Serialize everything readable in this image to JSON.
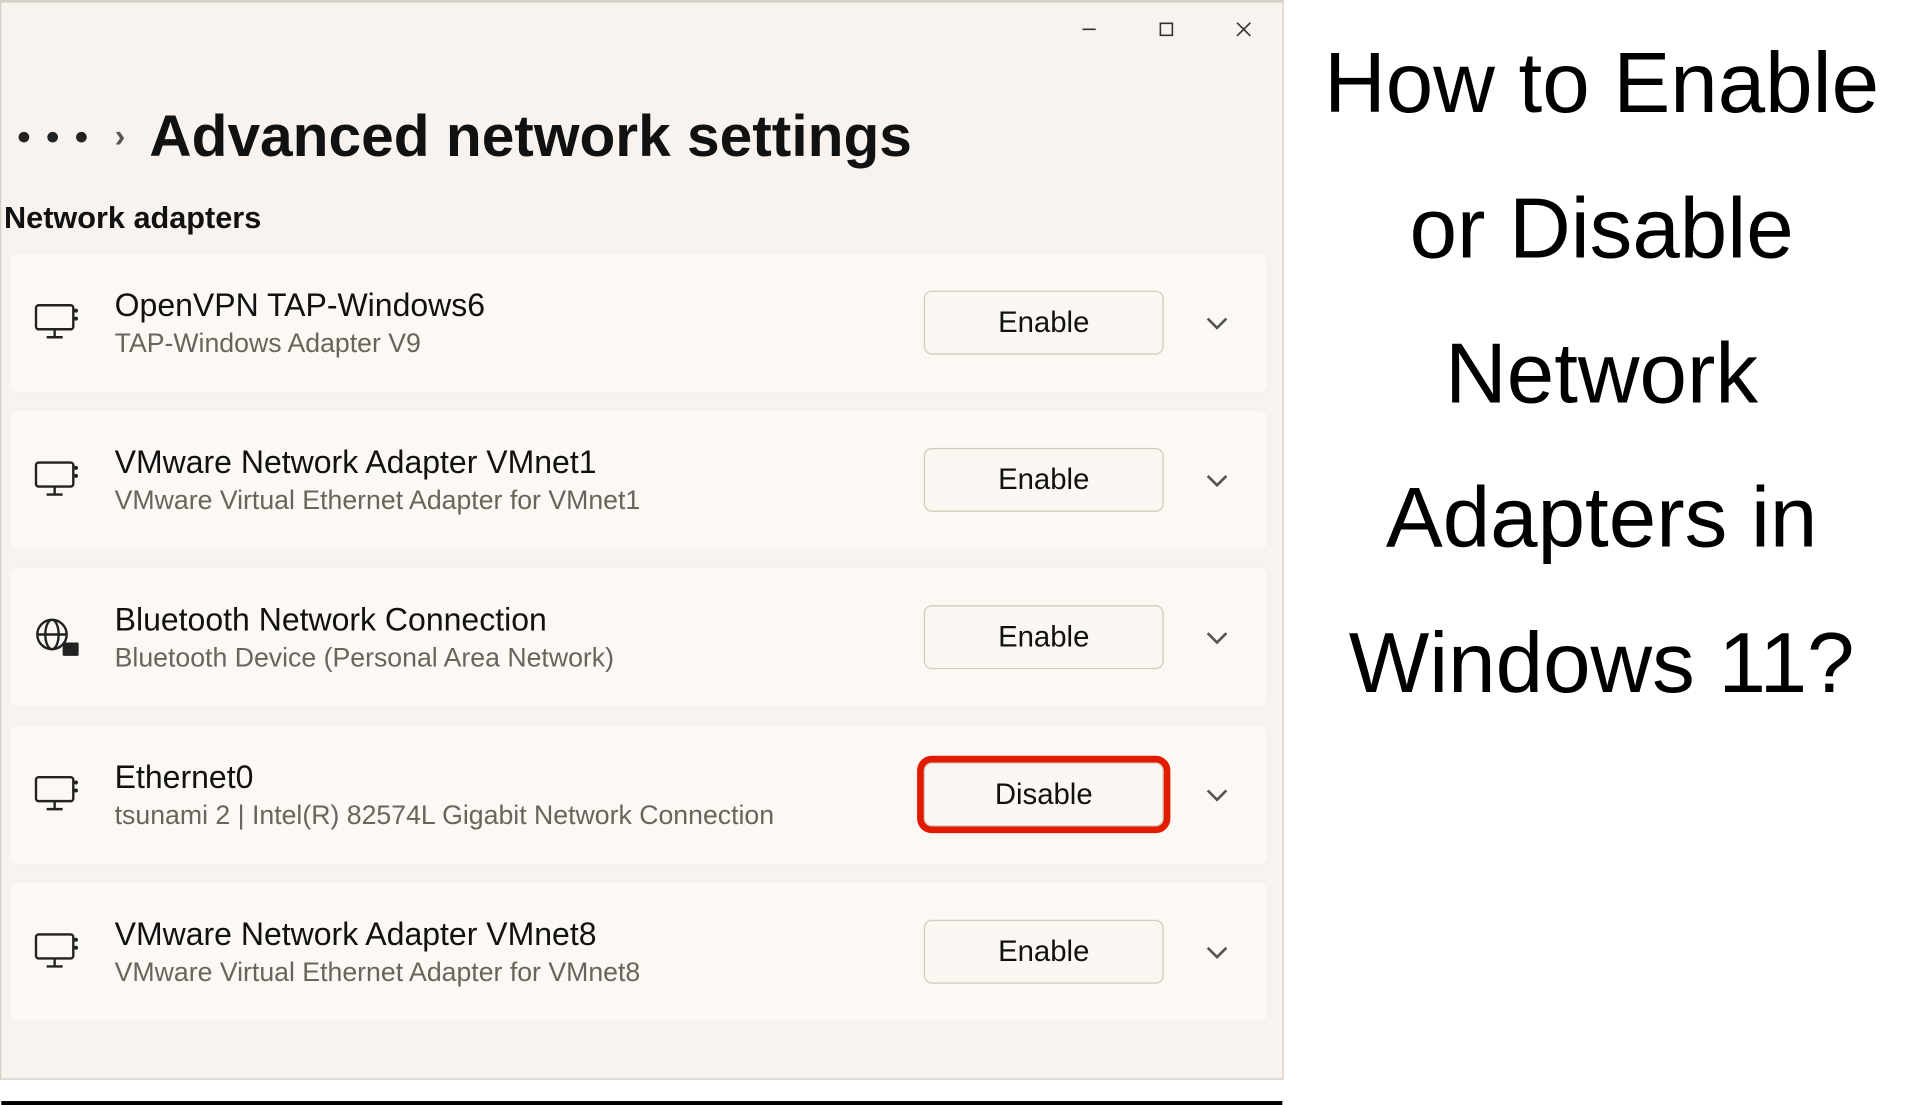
{
  "page_title": "Advanced network settings",
  "section_label": "Network adapters",
  "side_text": "How to Enable or Disable Network Adapters in Windows 11?",
  "adapters": [
    {
      "title": "OpenVPN TAP-Windows6",
      "sub": "TAP-Windows Adapter V9",
      "action": "Enable",
      "highlight": false,
      "icon": "monitor"
    },
    {
      "title": "VMware Network Adapter VMnet1",
      "sub": "VMware Virtual Ethernet Adapter for VMnet1",
      "action": "Enable",
      "highlight": false,
      "icon": "monitor"
    },
    {
      "title": "Bluetooth Network Connection",
      "sub": "Bluetooth Device (Personal Area Network)",
      "action": "Enable",
      "highlight": false,
      "icon": "globe"
    },
    {
      "title": "Ethernet0",
      "sub": "tsunami 2 | Intel(R) 82574L Gigabit Network Connection",
      "action": "Disable",
      "highlight": true,
      "icon": "monitor"
    },
    {
      "title": "VMware Network Adapter VMnet8",
      "sub": "VMware Virtual Ethernet Adapter for VMnet8",
      "action": "Enable",
      "highlight": false,
      "icon": "monitor"
    }
  ]
}
